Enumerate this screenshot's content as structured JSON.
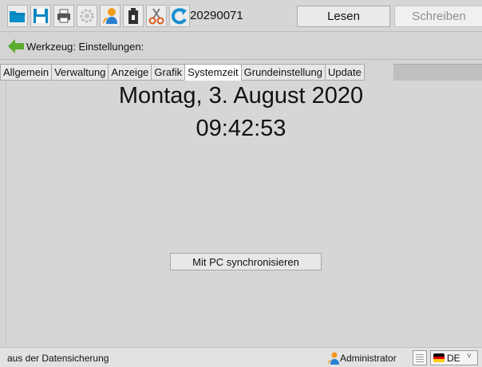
{
  "toolbar": {
    "device_id": "20290071",
    "read_label": "Lesen",
    "write_label": "Schreiben",
    "icons": [
      "folder-open-icon",
      "save-icon",
      "print-icon",
      "settings-icon",
      "user-icon",
      "battery-icon",
      "cut-icon",
      "refresh-icon"
    ]
  },
  "tool": {
    "label": "Werkzeug: Einstellungen:"
  },
  "tabs": [
    {
      "label": "Allgemein"
    },
    {
      "label": "Verwaltung"
    },
    {
      "label": "Anzeige"
    },
    {
      "label": "Grafik"
    },
    {
      "label": "Systemzeit",
      "active": true
    },
    {
      "label": "Grundeinstellung"
    },
    {
      "label": "Update"
    }
  ],
  "main": {
    "date": "Montag, 3. August 2020",
    "time": "09:42:53",
    "sync_label": "Mit PC synchronisieren"
  },
  "status": {
    "text": "aus der Datensicherung",
    "user": "Administrator",
    "language": "DE"
  },
  "colors": {
    "folder": "#0a8fc9",
    "save": "#0a86c4",
    "refresh": "#1a8fd0",
    "back_arrow": "#5aac2e",
    "user_orange": "#f29a1a",
    "user_blue": "#2a7fd0"
  }
}
